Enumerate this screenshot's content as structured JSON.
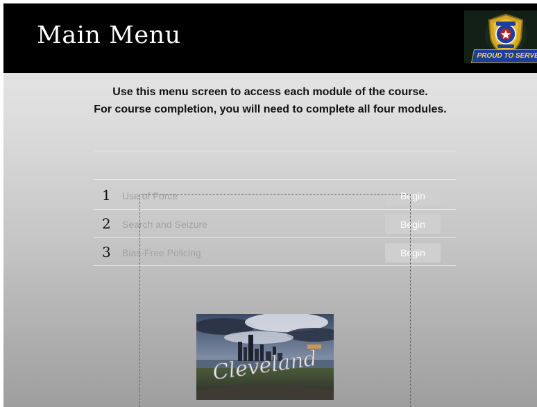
{
  "header": {
    "title": "Main Menu",
    "badge_banner": "PROUD TO SERVE"
  },
  "intro": {
    "line1": "Use this menu screen to access each module of the course.",
    "line2": "For course completion, you will need to complete all four modules."
  },
  "modules": [
    {
      "number": "1",
      "title": "Use of Force",
      "button": "Begin"
    },
    {
      "number": "2",
      "title": "Search and Seizure",
      "button": "Begin"
    },
    {
      "number": "3",
      "title": "Bias-Free Policing",
      "button": "Begin"
    }
  ],
  "photo": {
    "sign_text": "Cleveland"
  },
  "colors": {
    "header_bg": "#000000",
    "badge_gold": "#d4a520",
    "badge_blue": "#1d3e9a"
  }
}
